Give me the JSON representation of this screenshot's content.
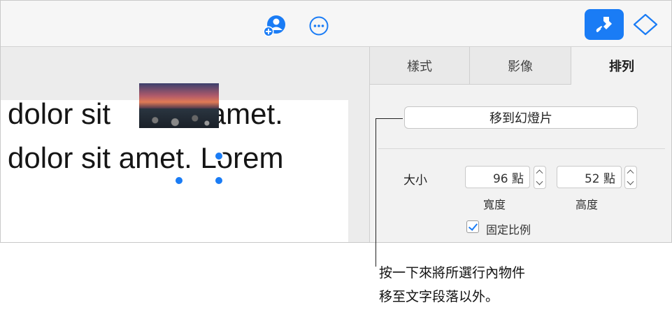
{
  "toolbar": {
    "collaborate_icon": "add-person-icon",
    "more_icon": "ellipsis-circle-icon",
    "format_icon": "paintbrush-icon",
    "animate_icon": "diamond-icon",
    "accent_color": "#1a7cf5"
  },
  "document": {
    "line1_before": "dolor sit ",
    "line1_after": "amet.",
    "line2": "dolor sit amet. Lorem"
  },
  "sidebar": {
    "tabs": [
      {
        "label": "樣式"
      },
      {
        "label": "影像"
      },
      {
        "label": "排列"
      }
    ],
    "move_button": "移到幻燈片",
    "size_label": "大小",
    "width_value": "96 點",
    "height_value": "52 點",
    "width_label": "寬度",
    "height_label": "高度",
    "constrain_label": "固定比例"
  },
  "callout": {
    "line1": "按一下來將所選行內物件",
    "line2": "移至文字段落以外。"
  }
}
